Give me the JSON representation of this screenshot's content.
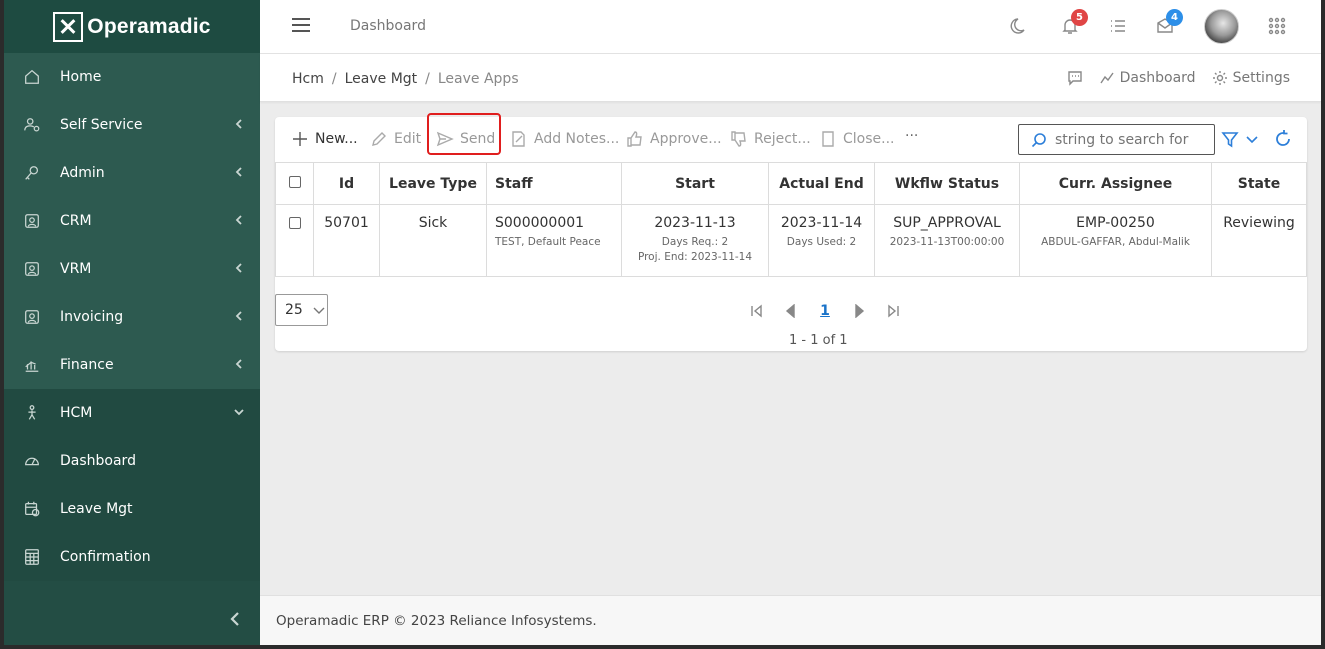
{
  "app": {
    "name": "Operamadic"
  },
  "sidebar": {
    "items": [
      {
        "label": "Home",
        "icon": "home-icon",
        "expandable": false
      },
      {
        "label": "Self Service",
        "icon": "user-settings-icon",
        "expandable": true
      },
      {
        "label": "Admin",
        "icon": "key-icon",
        "expandable": true
      },
      {
        "label": "CRM",
        "icon": "contact-icon",
        "expandable": true
      },
      {
        "label": "VRM",
        "icon": "contact-icon",
        "expandable": true
      },
      {
        "label": "Invoicing",
        "icon": "contact-icon",
        "expandable": true
      },
      {
        "label": "Finance",
        "icon": "finance-icon",
        "expandable": true
      },
      {
        "label": "HCM",
        "icon": "person-icon",
        "expandable": true,
        "expanded": true
      },
      {
        "label": "Dashboard",
        "icon": "gauge-icon",
        "expandable": false
      },
      {
        "label": "Leave Mgt",
        "icon": "calendar-clock-icon",
        "expandable": false
      },
      {
        "label": "Confirmation",
        "icon": "grid-calc-icon",
        "expandable": false
      }
    ]
  },
  "topbar": {
    "title": "Dashboard",
    "notifications_count": "5",
    "messages_count": "4"
  },
  "breadcrumb": {
    "items": [
      "Hcm",
      "Leave Mgt",
      "Leave Apps"
    ],
    "actions": {
      "dashboard": "Dashboard",
      "settings": "Settings"
    }
  },
  "toolbar": {
    "new": "New...",
    "edit": "Edit",
    "send": "Send",
    "add_notes": "Add Notes...",
    "approve": "Approve...",
    "reject": "Reject...",
    "close": "Close...",
    "more": "···",
    "search_placeholder": "string to search for"
  },
  "table": {
    "headers": [
      "Id",
      "Leave Type",
      "Staff",
      "Start",
      "Actual End",
      "Wkflw Status",
      "Curr. Assignee",
      "State"
    ],
    "rows": [
      {
        "id": "50701",
        "leave_type": "Sick",
        "staff": "S000000001",
        "staff_name": "TEST, Default Peace",
        "start": "2023-11-13",
        "days_req": "Days Req.: 2",
        "proj_end": "Proj. End: 2023-11-14",
        "actual_end": "2023-11-14",
        "days_used": "Days Used: 2",
        "wkflw_status": "SUP_APPROVAL",
        "wkflw_date": "2023-11-13T00:00:00",
        "assignee": "EMP-00250",
        "assignee_name": "ABDUL-GAFFAR, Abdul-Malik",
        "state": "Reviewing"
      }
    ]
  },
  "pager": {
    "page_size": "25",
    "current_page": "1",
    "info": "1 - 1 of 1"
  },
  "footer": {
    "text": "Operamadic ERP © 2023 Reliance Infosystems."
  },
  "colors": {
    "sidebar": "#234d44",
    "accent": "#2d7fd9",
    "highlight": "#e01e1e"
  }
}
